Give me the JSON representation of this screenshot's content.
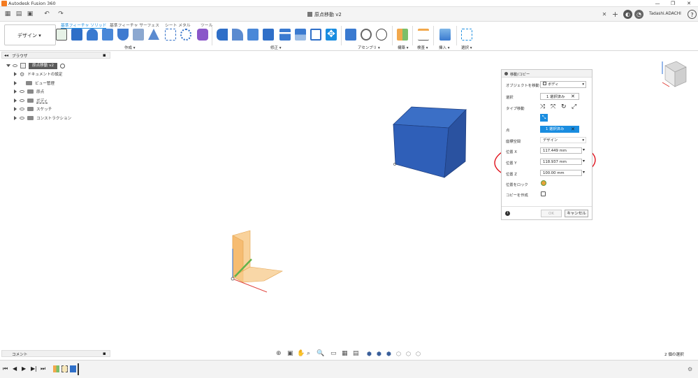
{
  "app": {
    "title": "Autodesk Fusion 360"
  },
  "document": {
    "title": "原点移動 v2"
  },
  "user": {
    "name": "Tadashi.ADACHI"
  },
  "toolbar": {
    "workspace": "デザイン",
    "tabs": [
      "ソリッド",
      "サーフェス",
      "シート メタル",
      "ツール"
    ],
    "active_tab_prefix": "基準フィーチャ",
    "groups": {
      "create": "作成",
      "modify": "修正",
      "assemble": "アセンブリ",
      "construct": "構築",
      "inspect": "検査",
      "insert": "挿入",
      "select": "選択"
    }
  },
  "browser": {
    "header": "ブラウザ",
    "root": "原点移動 v2",
    "items": [
      "ドキュメントの設定",
      "ビュー管理",
      "原点",
      "ボディ",
      "スケッチ",
      "コンストラクション"
    ]
  },
  "panel": {
    "title": "移動/コピー",
    "object_label": "オブジェクトを移動",
    "object_value": "ボディ",
    "select_label": "選択",
    "select_value": "1 選択済み",
    "move_type_label": "タイプ移動",
    "point_label": "点",
    "point_value": "1 選択済み",
    "coord_label": "座標空間",
    "coord_value": "デザイン",
    "pos_x_label": "位置 X",
    "pos_x": "117.449 mm",
    "pos_y_label": "位置 Y",
    "pos_y": "118.937 mm",
    "pos_z_label": "位置 Z",
    "pos_z": "100.00 mm",
    "pos_lock_label": "位置をロック",
    "copy_label": "コピーを作成",
    "ok": "OK",
    "cancel": "キャンセル"
  },
  "bottom": {
    "comment": "コメント",
    "status": "2 個の選択"
  },
  "colors": {
    "accent": "#1a8de0",
    "cube": "#2f5fb8",
    "origin_plane": "#f7c37a",
    "annotation": "#e0101a"
  }
}
